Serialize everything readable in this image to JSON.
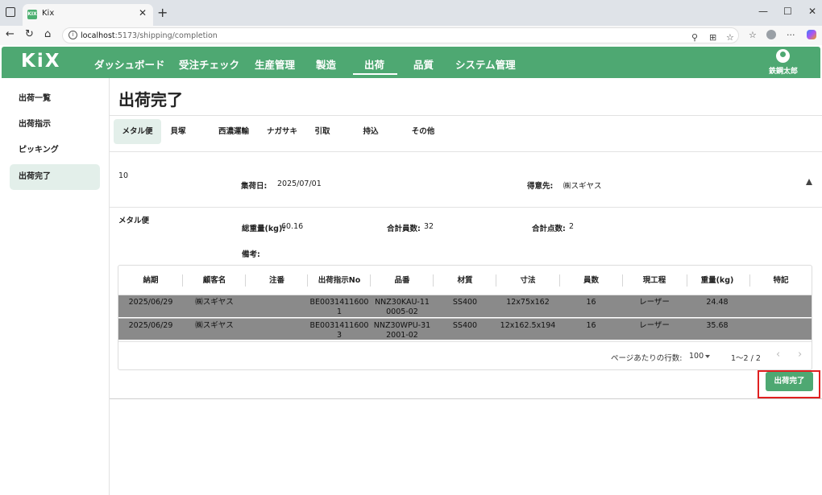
{
  "browser": {
    "tab_title": "Kix",
    "tab_favicon": "KIX",
    "url_host": "localhost",
    "url_rest": ":5173/shipping/completion"
  },
  "app": {
    "logo": "KiX",
    "nav": [
      "ダッシュボード",
      "受注チェック",
      "生産管理",
      "製造",
      "出荷",
      "品質",
      "システム管理"
    ],
    "active_nav": "出荷",
    "user_name": "鉄鋼太郎"
  },
  "sidebar": {
    "items": [
      "出荷一覧",
      "出荷指示",
      "ピッキング",
      "出荷完了"
    ],
    "active": "出荷完了"
  },
  "page_title": "出荷完了",
  "shipping_tabs": [
    "メタル便",
    "貝塚",
    "西濃運輸",
    "ナガサキ",
    "引取",
    "持込",
    "その他"
  ],
  "active_shipping_tab": "メタル便",
  "summary": {
    "id": "10",
    "pickup_label": "集荷日:",
    "pickup_value": "2025/07/01",
    "customer_label": "得意先:",
    "customer_value": "㈱スギヤス"
  },
  "detail": {
    "carrier": "メタル便",
    "total_weight_label": "総重量(kg):",
    "total_weight_value": "60.16",
    "total_staff_label": "合計員数:",
    "total_staff_value": "32",
    "total_items_label": "合計点数:",
    "total_items_value": "2",
    "note_label": "備考:"
  },
  "table": {
    "columns": [
      "納期",
      "顧客名",
      "注番",
      "出荷指示No",
      "品番",
      "材質",
      "寸法",
      "員数",
      "現工程",
      "重量(kg)",
      "特記"
    ],
    "rows": [
      [
        "2025/06/29",
        "㈱スギヤス",
        "",
        [
          "BE0031411600",
          "1"
        ],
        [
          "NNZ30KAU-11",
          "0005-02"
        ],
        "SS400",
        "12x75x162",
        "16",
        "レーザー",
        "24.48",
        ""
      ],
      [
        "2025/06/29",
        "㈱スギヤス",
        "",
        [
          "BE0031411600",
          "3"
        ],
        [
          "NNZ30WPU-31",
          "2001-02"
        ],
        "SS400",
        "12x162.5x194",
        "16",
        "レーザー",
        "35.68",
        ""
      ]
    ],
    "rows_per_page_label": "ページあたりの行数:",
    "rows_per_page_value": "100",
    "range_label": "1〜2 / 2"
  },
  "complete_button": "出荷完了",
  "colors": {
    "brand_green": "#4ea872",
    "active_bg": "#e3efea",
    "highlight_red": "#e02020",
    "selected_row": "#8a8a8a"
  },
  "icons": [
    "sidebar-toggle-icon",
    "back-icon",
    "reload-icon",
    "home-icon",
    "site-info-icon",
    "read-aloud-icon",
    "extensions-icon",
    "favorite-icon",
    "favorites-icon",
    "profile-icon",
    "more-icon",
    "copilot-icon",
    "user-icon",
    "collapse-icon",
    "chevron-left-icon",
    "chevron-right-icon",
    "dropdown-caret-icon"
  ]
}
